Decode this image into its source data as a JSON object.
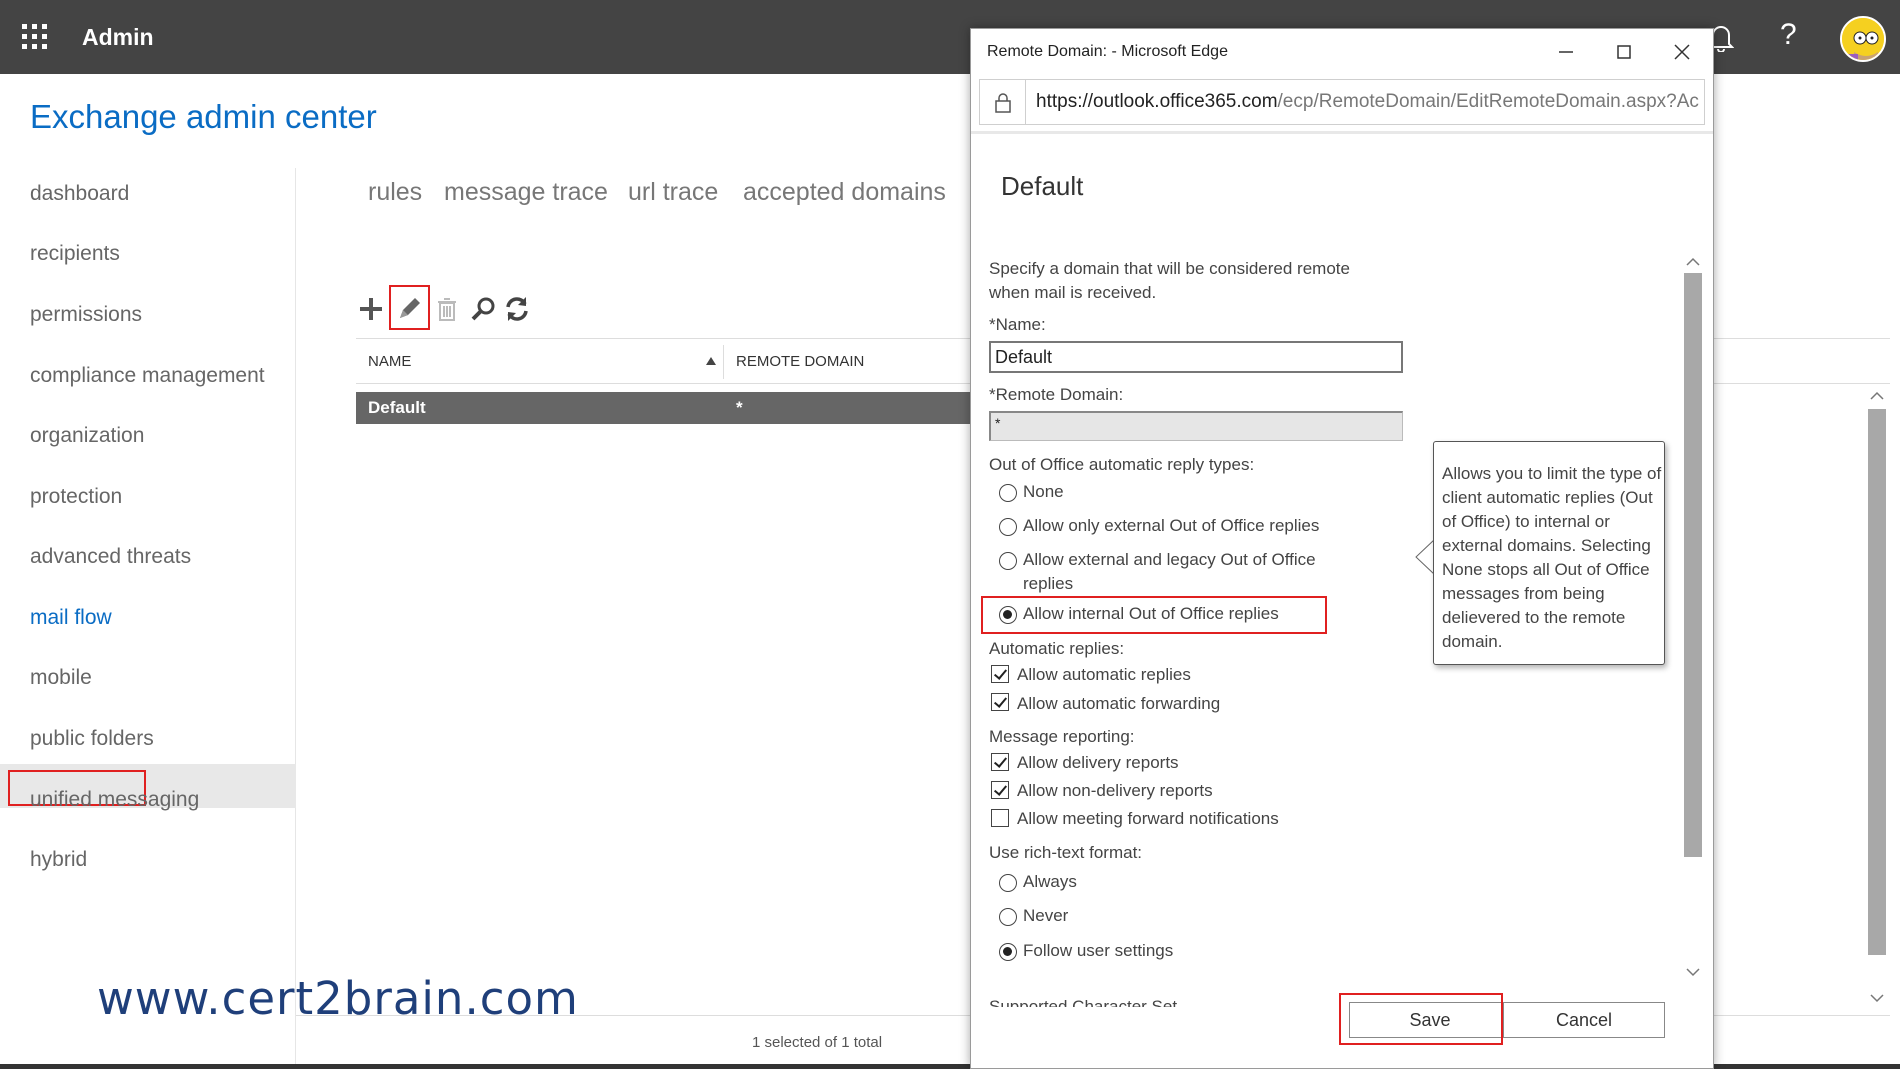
{
  "topbar": {
    "app_title": "Admin",
    "help_label": "?"
  },
  "eac": {
    "title": "Exchange admin center"
  },
  "sidebar": {
    "items": [
      {
        "label": "dashboard"
      },
      {
        "label": "recipients"
      },
      {
        "label": "permissions"
      },
      {
        "label": "compliance management"
      },
      {
        "label": "organization"
      },
      {
        "label": "protection"
      },
      {
        "label": "advanced threats"
      },
      {
        "label": "mail flow"
      },
      {
        "label": "mobile"
      },
      {
        "label": "public folders"
      },
      {
        "label": "unified messaging"
      },
      {
        "label": "hybrid"
      }
    ],
    "active": "mail flow"
  },
  "subtabs": [
    {
      "label": "rules"
    },
    {
      "label": "message trace"
    },
    {
      "label": "url trace"
    },
    {
      "label": "accepted domains"
    }
  ],
  "toolbar": {
    "add": "add-icon",
    "edit": "pencil-icon",
    "delete": "trash-icon",
    "search": "search-icon",
    "refresh": "refresh-icon"
  },
  "table": {
    "columns": [
      "NAME",
      "REMOTE DOMAIN"
    ],
    "rows": [
      {
        "name": "Default",
        "domain": "*"
      }
    ],
    "status": "1 selected of 1 total"
  },
  "watermark": "www.cert2brain.com",
  "dialog": {
    "window_title": "Remote Domain: - Microsoft Edge",
    "url_host": "https://outlook.office365.com",
    "url_path": "/ecp/RemoteDomain/EditRemoteDomain.aspx?Ac",
    "heading": "Default",
    "description": "Specify a domain that will be considered remote when mail is received.",
    "name_label": "*Name:",
    "name_value": "Default",
    "remote_domain_label": "*Remote Domain:",
    "remote_domain_value": "*",
    "ooo_label": "Out of Office automatic reply types:",
    "ooo_options": [
      {
        "label": "None",
        "selected": false
      },
      {
        "label": "Allow only external Out of Office replies",
        "selected": false
      },
      {
        "label": "Allow external and legacy Out of Office replies",
        "selected": false
      },
      {
        "label": "Allow internal Out of Office replies",
        "selected": true
      }
    ],
    "auto_label": "Automatic replies:",
    "auto_options": [
      {
        "label": "Allow automatic replies",
        "checked": true
      },
      {
        "label": "Allow automatic forwarding",
        "checked": true
      }
    ],
    "report_label": "Message reporting:",
    "report_options": [
      {
        "label": "Allow delivery reports",
        "checked": true
      },
      {
        "label": "Allow non-delivery reports",
        "checked": true
      },
      {
        "label": "Allow meeting forward notifications",
        "checked": false
      }
    ],
    "rtf_label": "Use rich-text format:",
    "rtf_options": [
      {
        "label": "Always",
        "selected": false
      },
      {
        "label": "Never",
        "selected": false
      },
      {
        "label": "Follow user settings",
        "selected": true
      }
    ],
    "charset_label": "Supported Character Set",
    "tooltip": "Allows you to limit the type of client automatic replies (Out of Office) to internal or external domains. Selecting None stops all Out of Office messages from being delievered to the remote domain.",
    "save_label": "Save",
    "cancel_label": "Cancel"
  }
}
